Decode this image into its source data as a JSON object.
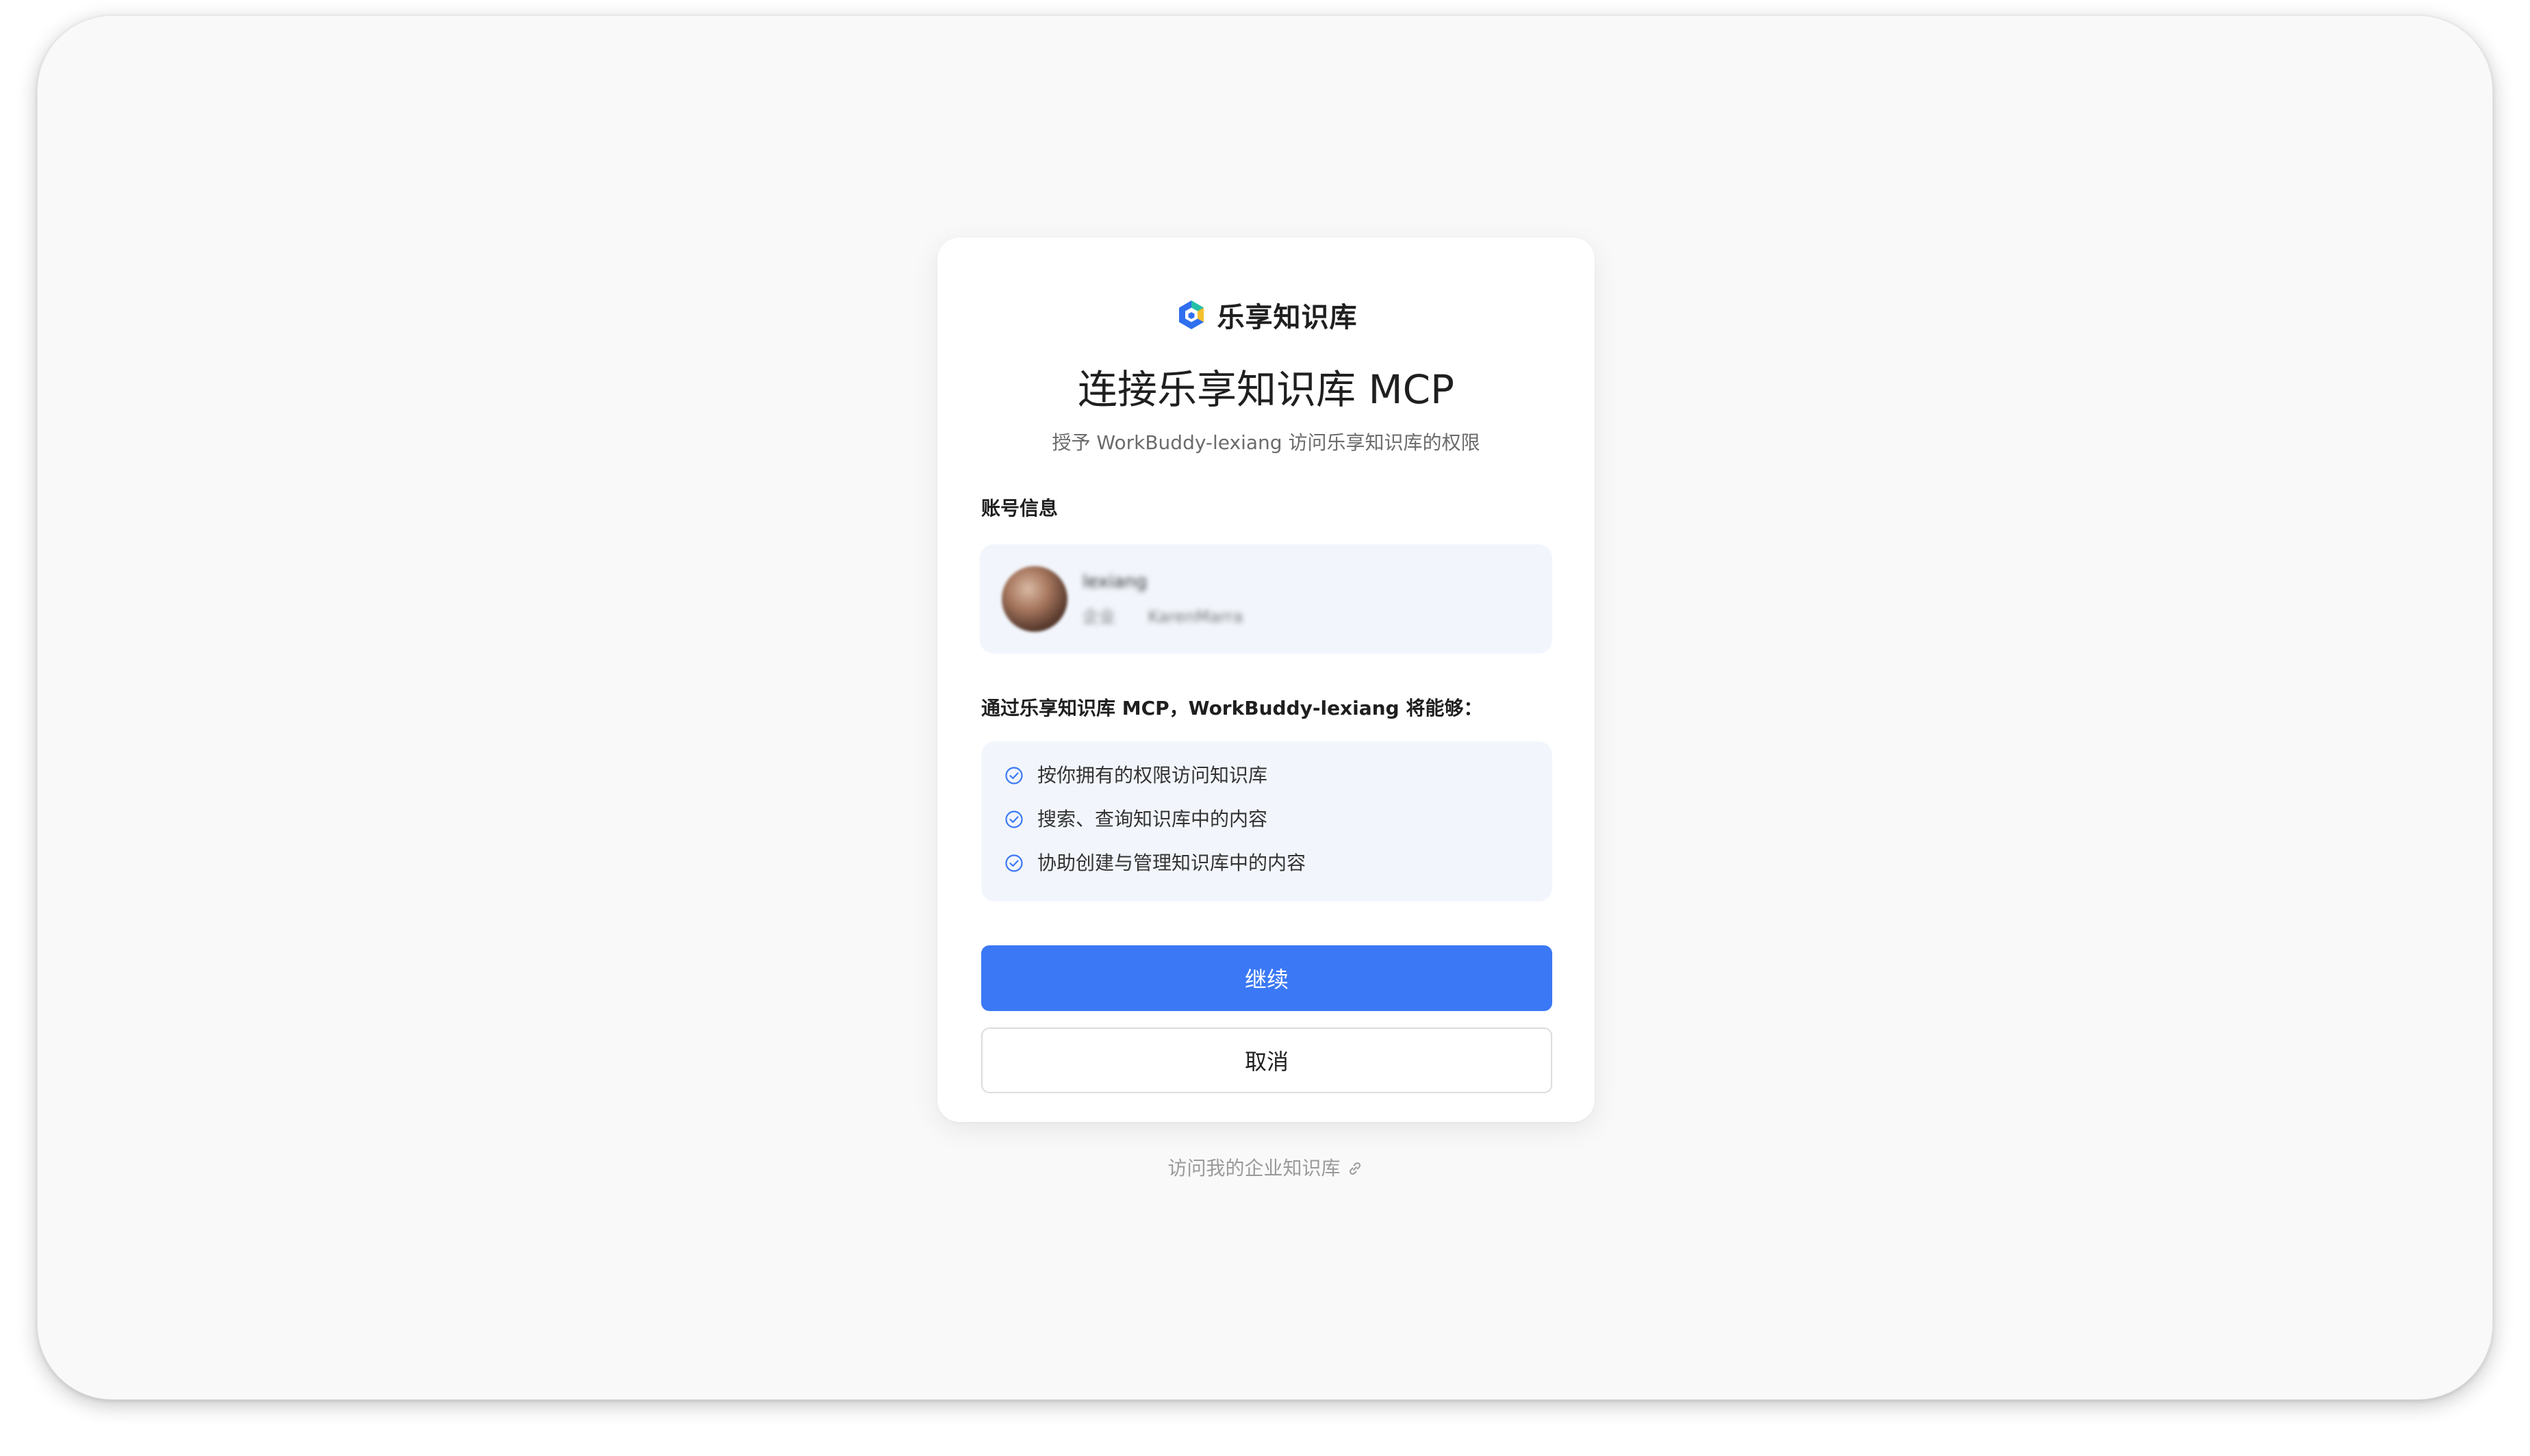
{
  "brand": {
    "name": "乐享知识库",
    "logo_icon": "lexiang-logo-icon"
  },
  "title": "连接乐享知识库 MCP",
  "subtitle": "授予 WorkBuddy-lexiang 访问乐享知识库的权限",
  "account": {
    "label": "账号信息",
    "name": "lexiang",
    "meta": [
      "企业",
      "KarenMarra"
    ]
  },
  "permissions": {
    "intro": "通过乐享知识库 MCP，WorkBuddy-lexiang 将能够：",
    "items": [
      "按你拥有的权限访问知识库",
      "搜索、查询知识库中的内容",
      "协助创建与管理知识库中的内容"
    ],
    "icon": "check-circle-icon"
  },
  "actions": {
    "continue": "继续",
    "cancel": "取消"
  },
  "footer": {
    "link_text": "访问我的企业知识库",
    "icon": "link-icon"
  },
  "colors": {
    "primary": "#3b78f5",
    "background": "#f9f9f9",
    "panel": "#f2f6fc",
    "text": "#1f1f1f",
    "muted": "#9a9a9a"
  }
}
